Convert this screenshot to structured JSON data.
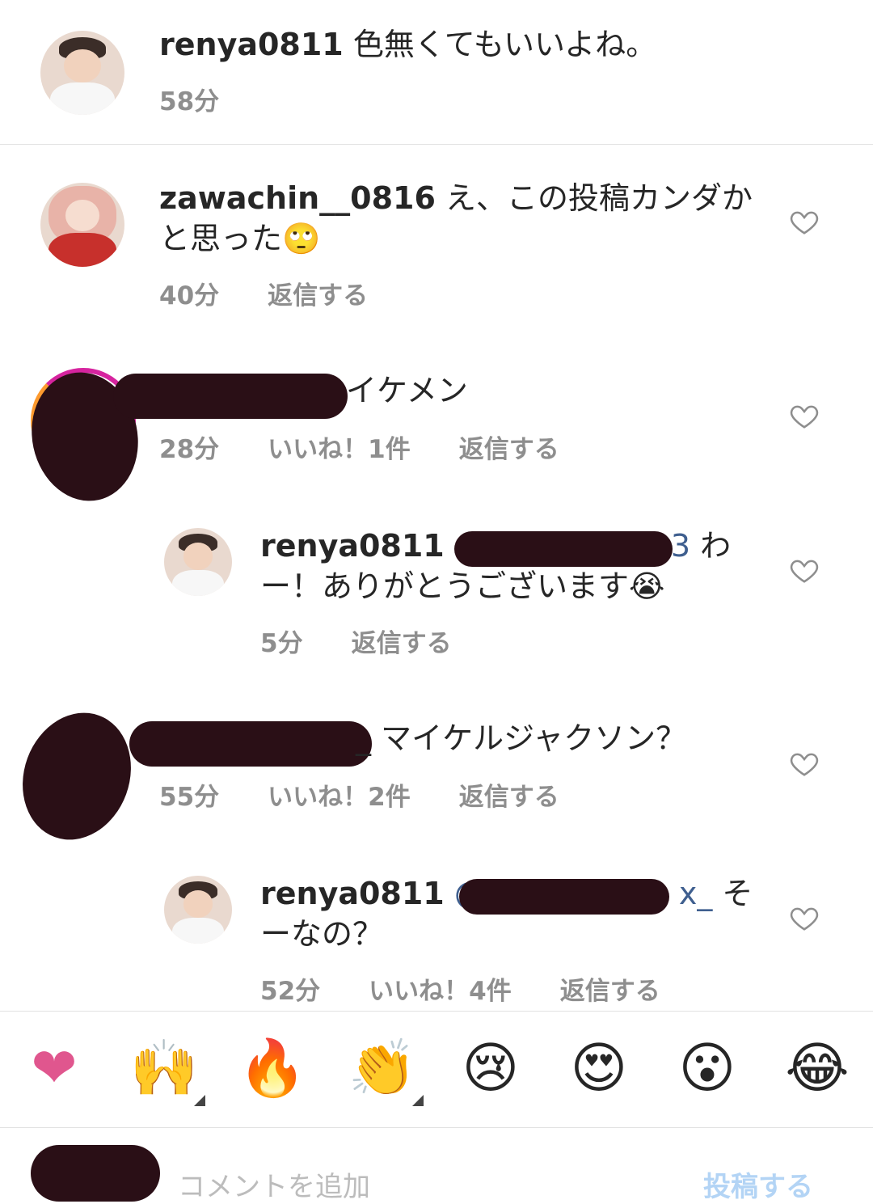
{
  "comments": [
    {
      "username": "renya0811",
      "text": " 色無くてもいいよね。",
      "time": "58分"
    },
    {
      "username": "zawachin__0816",
      "text": " え、この投稿カンダかと思った🙄",
      "time": "40分",
      "reply": "返信する"
    },
    {
      "text": "イケメン",
      "time": "28分",
      "likes": "いいね！1件",
      "reply": "返信する"
    },
    {
      "username": "renya0811",
      "mention": "@",
      "mention_tail": "3",
      "text": " わー！ありがとうございます😭",
      "time": "5分",
      "reply": "返信する"
    },
    {
      "text": "_ マイケルジャクソン？",
      "time": "55分",
      "likes": "いいね！2件",
      "reply": "返信する"
    },
    {
      "username": "renya0811",
      "mention": "@",
      "mention_tail": "x_",
      "text": " そーなの？",
      "time": "52分",
      "likes": "いいね！4件",
      "reply": "返信する"
    }
  ],
  "emoji_bar": [
    "❤",
    "🙌",
    "🔥",
    "👏",
    "😢",
    "😍",
    "😮",
    "😂"
  ],
  "add_comment": {
    "placeholder": "コメントを追加",
    "post": "投稿する"
  }
}
